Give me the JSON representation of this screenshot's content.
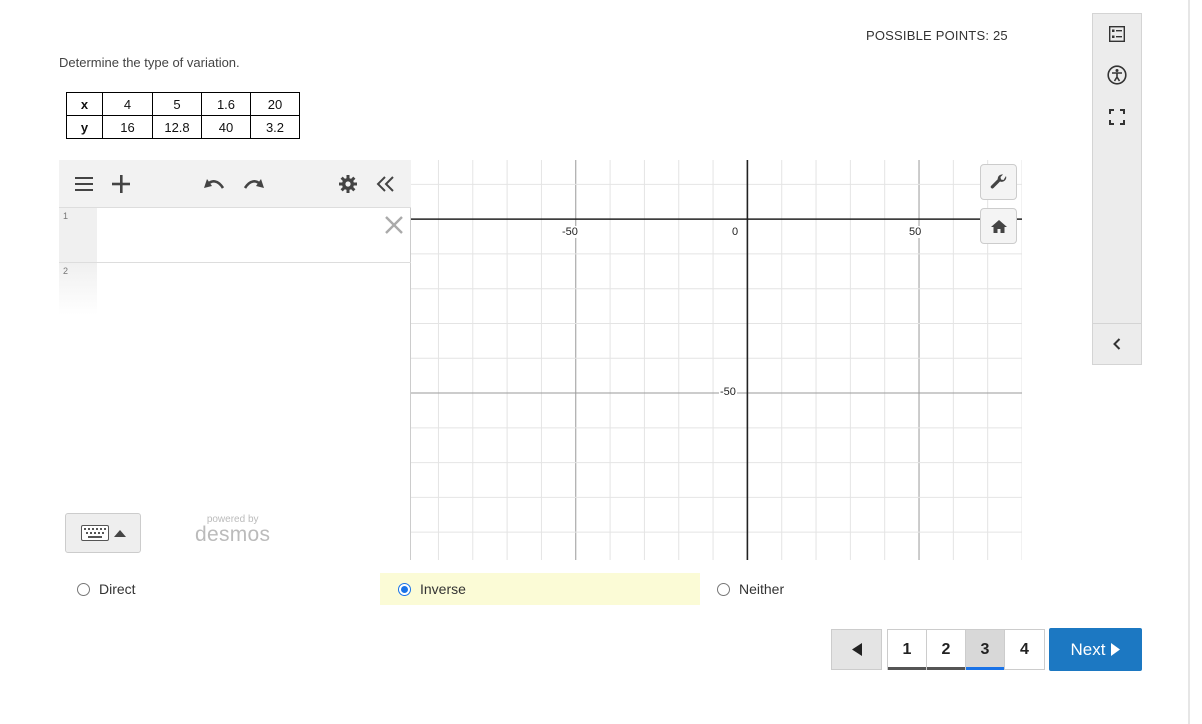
{
  "header": {
    "possible_points": "POSSIBLE POINTS: 25"
  },
  "question": {
    "prompt": "Determine the type of variation."
  },
  "table": {
    "row_x": {
      "label": "x",
      "values": [
        "4",
        "5",
        "1.6",
        "20"
      ]
    },
    "row_y": {
      "label": "y",
      "values": [
        "16",
        "12.8",
        "40",
        "3.2"
      ]
    }
  },
  "calculator": {
    "toolbar_icons": [
      "menu-icon",
      "plus-icon",
      "undo-icon",
      "redo-icon",
      "gear-icon",
      "collapse-icon"
    ],
    "expressions": [
      {
        "num": "1",
        "value": ""
      },
      {
        "num": "2",
        "value": ""
      }
    ],
    "powered_by": "powered by",
    "brand": "desmos",
    "axis_ticks": {
      "x_neg": "-50",
      "origin": "0",
      "x_pos": "50",
      "y_neg": "-50"
    },
    "grid_minor_step": 10,
    "x_range": [
      -98,
      80
    ],
    "y_range": [
      -98,
      17
    ]
  },
  "choices": [
    {
      "label": "Direct",
      "selected": false
    },
    {
      "label": "Inverse",
      "selected": true
    },
    {
      "label": "Neither",
      "selected": false
    }
  ],
  "pager": {
    "pages": [
      "1",
      "2",
      "3",
      "4"
    ],
    "current": "3",
    "next_label": "Next"
  },
  "colors": {
    "accent": "#1a73e8",
    "next_button": "#1c78c2",
    "selected_choice_bg": "#fbfbd6"
  }
}
